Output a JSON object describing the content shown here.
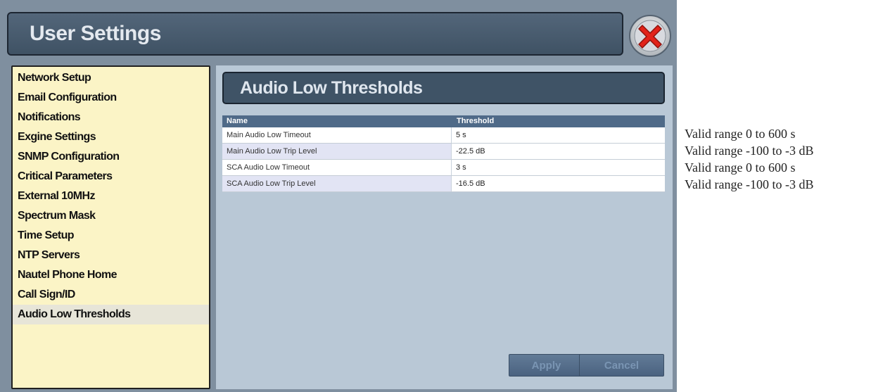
{
  "window": {
    "title": "User Settings"
  },
  "sidebar": {
    "items": [
      {
        "label": "Network Setup"
      },
      {
        "label": "Email Configuration"
      },
      {
        "label": "Notifications"
      },
      {
        "label": "Exgine Settings"
      },
      {
        "label": "SNMP Configuration"
      },
      {
        "label": "Critical Parameters"
      },
      {
        "label": "External 10MHz"
      },
      {
        "label": "Spectrum Mask"
      },
      {
        "label": "Time Setup"
      },
      {
        "label": "NTP Servers"
      },
      {
        "label": "Nautel Phone Home"
      },
      {
        "label": "Call Sign/ID"
      },
      {
        "label": "Audio Low Thresholds"
      }
    ],
    "active": "Audio Low Thresholds"
  },
  "panel": {
    "title": "Audio Low Thresholds",
    "table": {
      "headers": [
        "Name",
        "Threshold"
      ],
      "rows": [
        {
          "name": "Main Audio Low Timeout",
          "threshold": "5 s"
        },
        {
          "name": "Main Audio Low Trip Level",
          "threshold": "-22.5 dB"
        },
        {
          "name": "SCA Audio Low Timeout",
          "threshold": "3 s"
        },
        {
          "name": "SCA Audio Low Trip Level",
          "threshold": "-16.5 dB"
        }
      ]
    },
    "buttons": {
      "apply": "Apply",
      "cancel": "Cancel"
    }
  },
  "notes": [
    "Valid range 0 to 600 s",
    "Valid range -100 to -3 dB",
    "Valid range 0 to 600 s",
    "Valid range -100 to -3 dB"
  ],
  "colors": {
    "title_bar": "#3f5264",
    "sidebar_bg": "#fbf4c6",
    "content_bg": "#b9c8d6",
    "table_header": "#4f6a88",
    "close_icon": "#e2231a"
  },
  "icons": {
    "close": "close-x-icon"
  }
}
